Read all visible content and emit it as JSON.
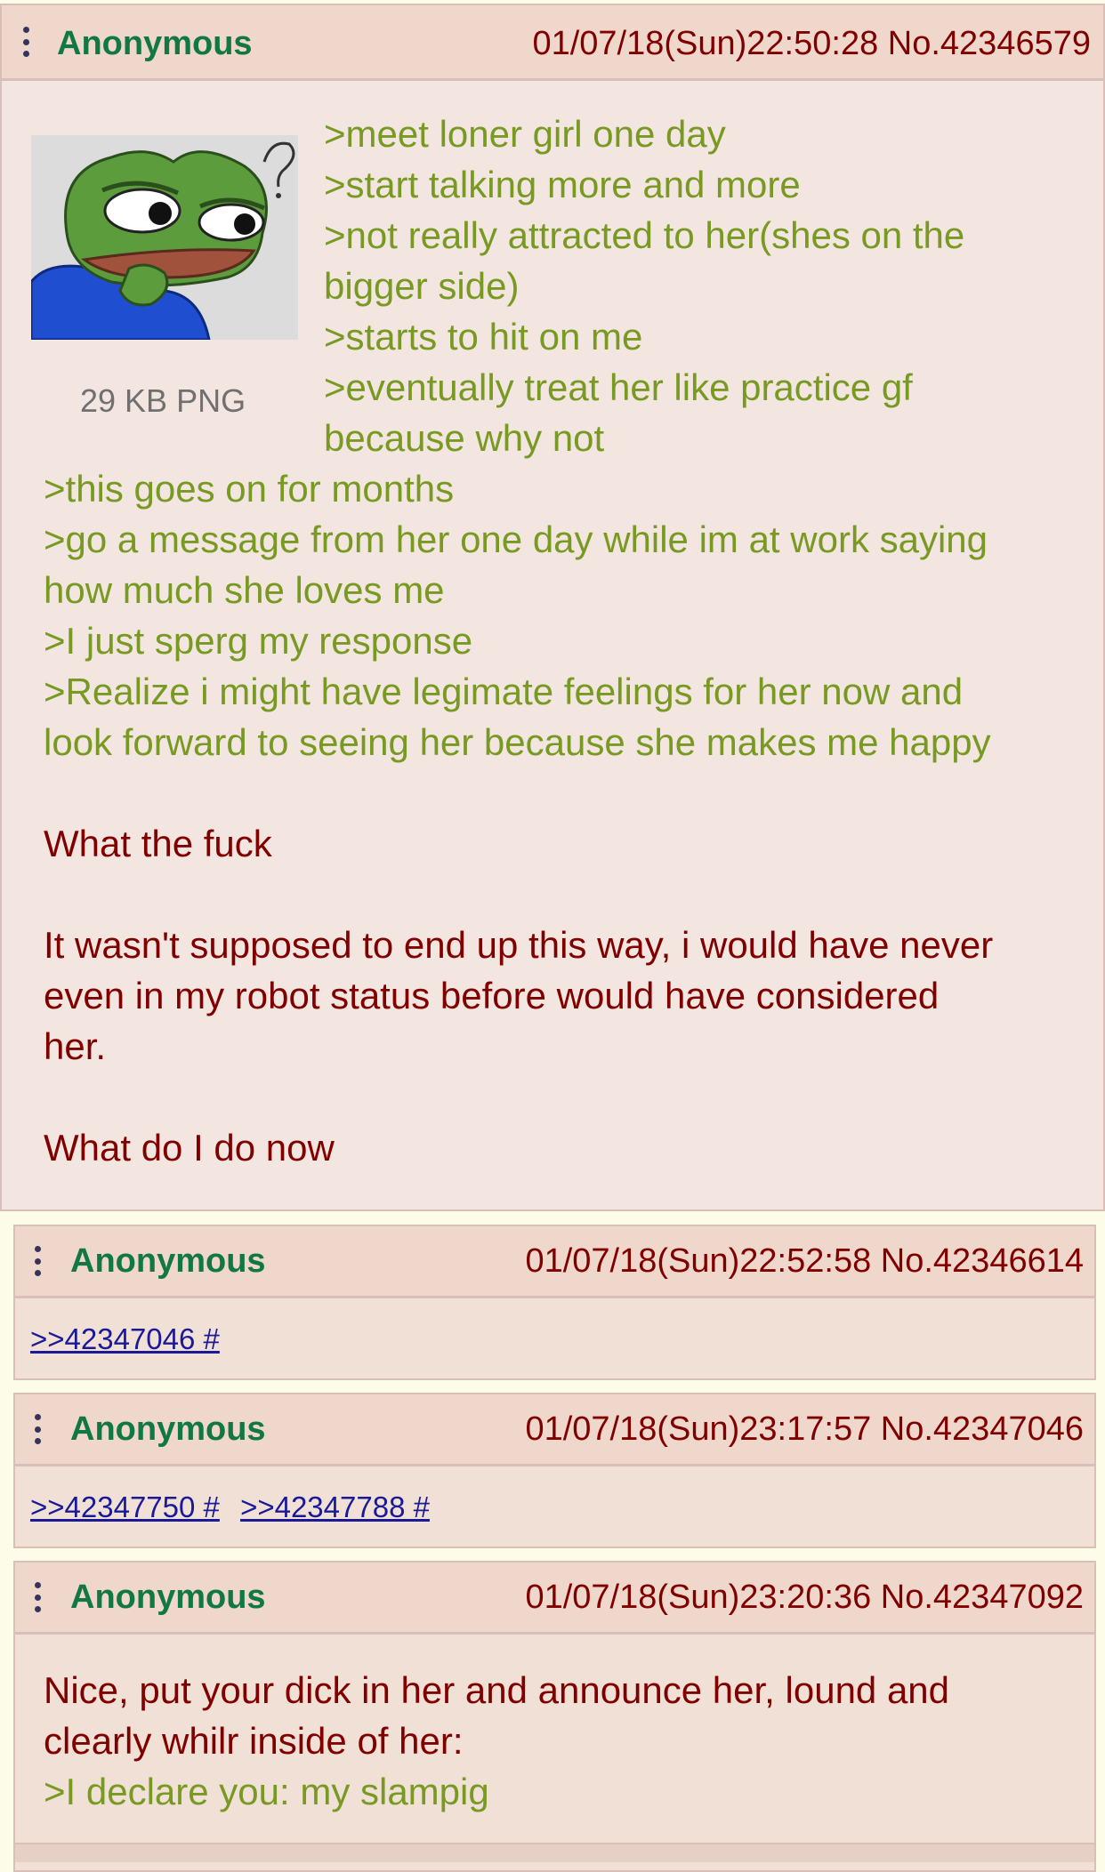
{
  "op": {
    "name": "Anonymous",
    "datetime": "01/07/18(Sun)22:50:28",
    "number": "No.42346579",
    "file_info": "29 KB PNG",
    "lines": [
      {
        "text": ">meet loner girl one day",
        "kind": "quote"
      },
      {
        "text": ">start talking more and more",
        "kind": "quote"
      },
      {
        "text": ">not really attracted to her(shes on the",
        "kind": "quote"
      },
      {
        "text": "bigger side)",
        "kind": "quote"
      },
      {
        "text": ">starts to hit on me",
        "kind": "quote"
      },
      {
        "text": ">eventually treat her like practice gf",
        "kind": "quote"
      },
      {
        "text": "because why not",
        "kind": "quote"
      },
      {
        "text": ">this goes on for months",
        "kind": "quote"
      },
      {
        "text": ">go a message from her one day while im at work saying",
        "kind": "quote"
      },
      {
        "text": "how much she loves me",
        "kind": "quote"
      },
      {
        "text": ">I just sperg my response",
        "kind": "quote"
      },
      {
        "text": ">Realize i might have legimate feelings for her now and",
        "kind": "quote"
      },
      {
        "text": "look forward to seeing her because she makes me happy",
        "kind": "quote"
      },
      {
        "text": "What the fuck",
        "kind": "text"
      },
      {
        "text": "It wasn't supposed to end up this way, i would have never",
        "kind": "text"
      },
      {
        "text": "even in my robot status before would have considered",
        "kind": "text"
      },
      {
        "text": "her.",
        "kind": "text"
      },
      {
        "text": "What do I do now",
        "kind": "text"
      }
    ]
  },
  "replies": [
    {
      "name": "Anonymous",
      "datetime": "01/07/18(Sun)22:52:58",
      "number": "No.42346614",
      "backlinks": [
        ">>42347046 #"
      ]
    },
    {
      "name": "Anonymous",
      "datetime": "01/07/18(Sun)23:17:57",
      "number": "No.42347046",
      "backlinks": [
        ">>42347750 #",
        ">>42347788 #"
      ]
    },
    {
      "name": "Anonymous",
      "datetime": "01/07/18(Sun)23:20:36",
      "number": "No.42347092",
      "lines": [
        {
          "text": "Nice, put your dick in her and announce her, lound and",
          "kind": "text"
        },
        {
          "text": "clearly whilr inside of her:",
          "kind": "text"
        },
        {
          "text": ">I declare you: my slampig",
          "kind": "quote"
        }
      ]
    }
  ],
  "colors": {
    "name": "#117743",
    "quote": "#789922",
    "text": "#800000",
    "link": "#1a1a99"
  },
  "thumbnail_icon": "thinking-frog-icon"
}
